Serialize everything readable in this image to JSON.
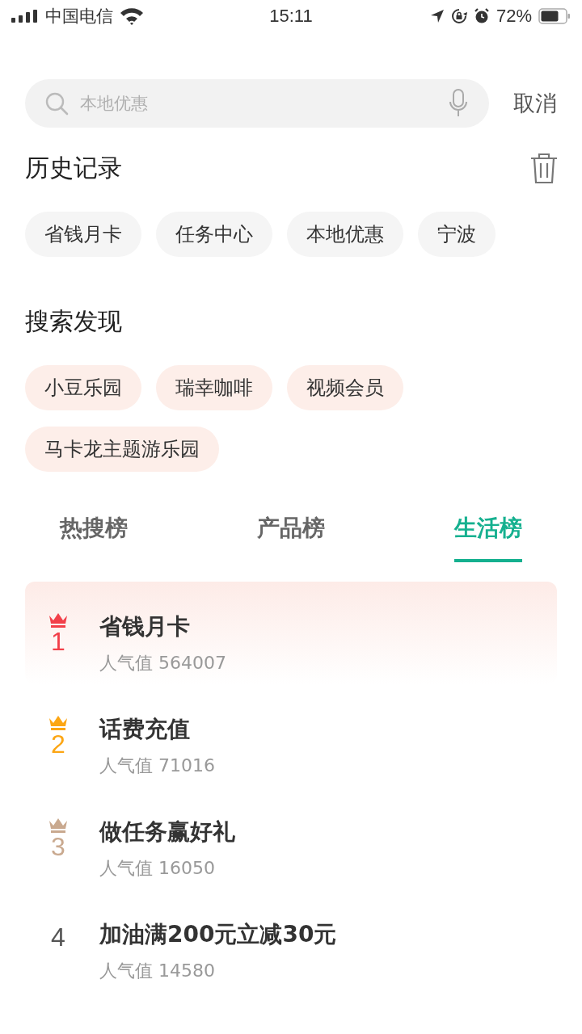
{
  "status_bar": {
    "carrier": "中国电信",
    "time": "15:11",
    "battery": "72%"
  },
  "search": {
    "placeholder": "本地优惠",
    "cancel": "取消"
  },
  "history": {
    "title": "历史记录",
    "tags": [
      "省钱月卡",
      "任务中心",
      "本地优惠",
      "宁波"
    ]
  },
  "discover": {
    "title": "搜索发现",
    "tags": [
      "小豆乐园",
      "瑞幸咖啡",
      "视频会员",
      "马卡龙主题游乐园"
    ]
  },
  "tabs": [
    {
      "label": "热搜榜",
      "selected": false
    },
    {
      "label": "产品榜",
      "selected": false
    },
    {
      "label": "生活榜",
      "selected": true
    }
  ],
  "ranking": [
    {
      "rank": "1",
      "kind": "crown",
      "color": "#f2404a",
      "highlighted": true,
      "title": "省钱月卡",
      "popularity": "人气值 564007"
    },
    {
      "rank": "2",
      "kind": "crown",
      "color": "#fca614",
      "highlighted": false,
      "title": "话费充值",
      "popularity": "人气值 71016"
    },
    {
      "rank": "3",
      "kind": "crown",
      "color": "#c9a98f",
      "highlighted": false,
      "title": "做任务赢好礼",
      "popularity": "人气值 16050"
    },
    {
      "rank": "4",
      "kind": "plain",
      "highlighted": false,
      "title": "加油满200元立减30元",
      "popularity": "人气值 14580"
    }
  ]
}
